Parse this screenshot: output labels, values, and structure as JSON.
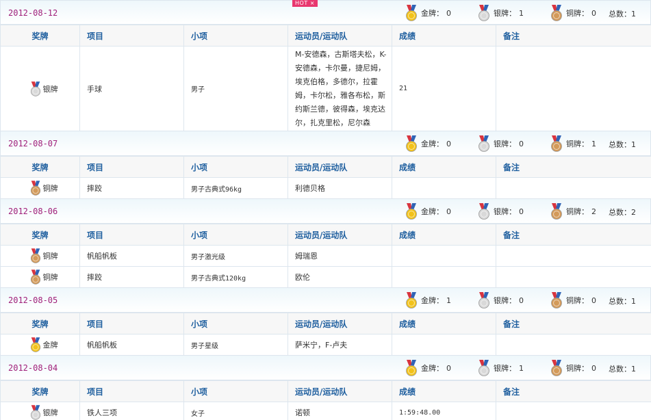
{
  "hot_badge": "HOT ×",
  "labels": {
    "gold": "金牌：",
    "silver": "银牌：",
    "bronze": "铜牌：",
    "total": "总数：",
    "col_medal": "奖牌",
    "col_event": "项目",
    "col_subevent": "小项",
    "col_athlete": "运动员/运动队",
    "col_result": "成绩",
    "col_note": "备注"
  },
  "colors": {
    "date": "#a0207a",
    "header_text": "#1f5f9f",
    "border": "#dde6ee",
    "gold": "#f2c21a",
    "silver": "#d9d9d9",
    "bronze": "#d39a5a",
    "ribbon_red": "#d8343f",
    "ribbon_blue": "#2f63b5",
    "hot": "#e8376e"
  },
  "days": [
    {
      "date": "2012-08-12",
      "gold": "0",
      "silver": "1",
      "bronze": "0",
      "total": "1",
      "rows": [
        {
          "medal": "silver",
          "medal_label": "银牌",
          "event": "手球",
          "subevent": "男子",
          "athlete": "M-安德森，古斯塔夫松，K-安德森，卡尔曼，捷尼姆，埃克伯格，多德尔，拉霍姆，卡尔松，雅各布松，斯约斯兰德，彼得森，埃克达尔，扎克里松，尼尔森",
          "result": "21",
          "note": ""
        }
      ]
    },
    {
      "date": "2012-08-07",
      "gold": "0",
      "silver": "0",
      "bronze": "1",
      "total": "1",
      "rows": [
        {
          "medal": "bronze",
          "medal_label": "铜牌",
          "event": "摔跤",
          "subevent": "男子古典式96kg",
          "athlete": "利德贝格",
          "result": "",
          "note": ""
        }
      ]
    },
    {
      "date": "2012-08-06",
      "gold": "0",
      "silver": "0",
      "bronze": "2",
      "total": "2",
      "rows": [
        {
          "medal": "bronze",
          "medal_label": "铜牌",
          "event": "帆船帆板",
          "subevent": "男子激光级",
          "athlete": "姆瑞恩",
          "result": "",
          "note": ""
        },
        {
          "medal": "bronze",
          "medal_label": "铜牌",
          "event": "摔跤",
          "subevent": "男子古典式120kg",
          "athlete": "欧伦",
          "result": "",
          "note": ""
        }
      ]
    },
    {
      "date": "2012-08-05",
      "gold": "1",
      "silver": "0",
      "bronze": "0",
      "total": "1",
      "rows": [
        {
          "medal": "gold",
          "medal_label": "金牌",
          "event": "帆船帆板",
          "subevent": "男子星级",
          "athlete": "萨米宁，F-卢夫",
          "result": "",
          "note": ""
        }
      ]
    },
    {
      "date": "2012-08-04",
      "gold": "0",
      "silver": "1",
      "bronze": "0",
      "total": "1",
      "rows": [
        {
          "medal": "silver",
          "medal_label": "银牌",
          "event": "铁人三项",
          "subevent": "女子",
          "athlete": "诺顿",
          "result": "1:59:48.00",
          "note": ""
        }
      ]
    }
  ]
}
